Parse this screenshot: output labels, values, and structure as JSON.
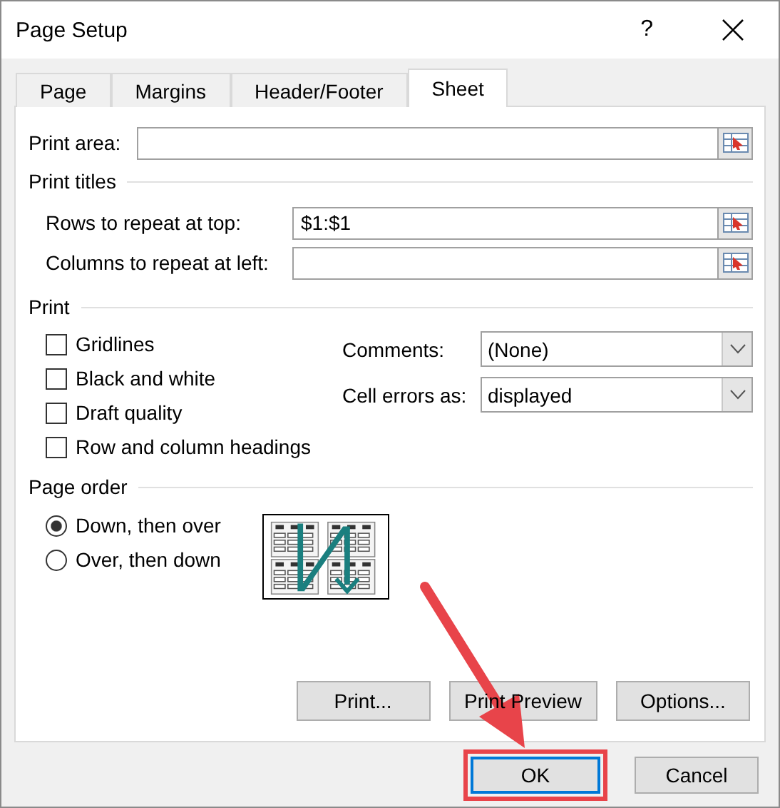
{
  "window": {
    "title": "Page Setup",
    "help": "?"
  },
  "tabs": [
    {
      "label": "Page",
      "selected": false
    },
    {
      "label": "Margins",
      "selected": false
    },
    {
      "label": "Header/Footer",
      "selected": false
    },
    {
      "label": "Sheet",
      "selected": true
    }
  ],
  "print_area": {
    "label": "Print area:"
  },
  "print_titles": {
    "heading": "Print titles",
    "rows": [
      {
        "label": "Rows to repeat at top:",
        "value": "$1:$1"
      },
      {
        "label": "Columns to repeat at left:"
      }
    ]
  },
  "print": {
    "heading": "Print",
    "options": [
      {
        "label": "Gridlines",
        "checked": false
      },
      {
        "label": "Black and white",
        "checked": false
      },
      {
        "label": "Draft quality",
        "checked": false
      },
      {
        "label": "Row and column headings",
        "checked": false
      }
    ],
    "dropdowns": [
      {
        "label": "Comments:",
        "value": "(None)"
      },
      {
        "label": "Cell errors as:",
        "value": "displayed"
      }
    ]
  },
  "page_order": {
    "heading": "Page order",
    "options": [
      {
        "label": "Down, then over",
        "selected": true
      },
      {
        "label": "Over, then down",
        "selected": false
      }
    ]
  },
  "panel_buttons": [
    "Print...",
    "Print Preview",
    "Options..."
  ],
  "buttons": [
    {
      "label": "OK",
      "highlighted": true
    },
    {
      "label": "Cancel",
      "highlighted": false
    }
  ]
}
